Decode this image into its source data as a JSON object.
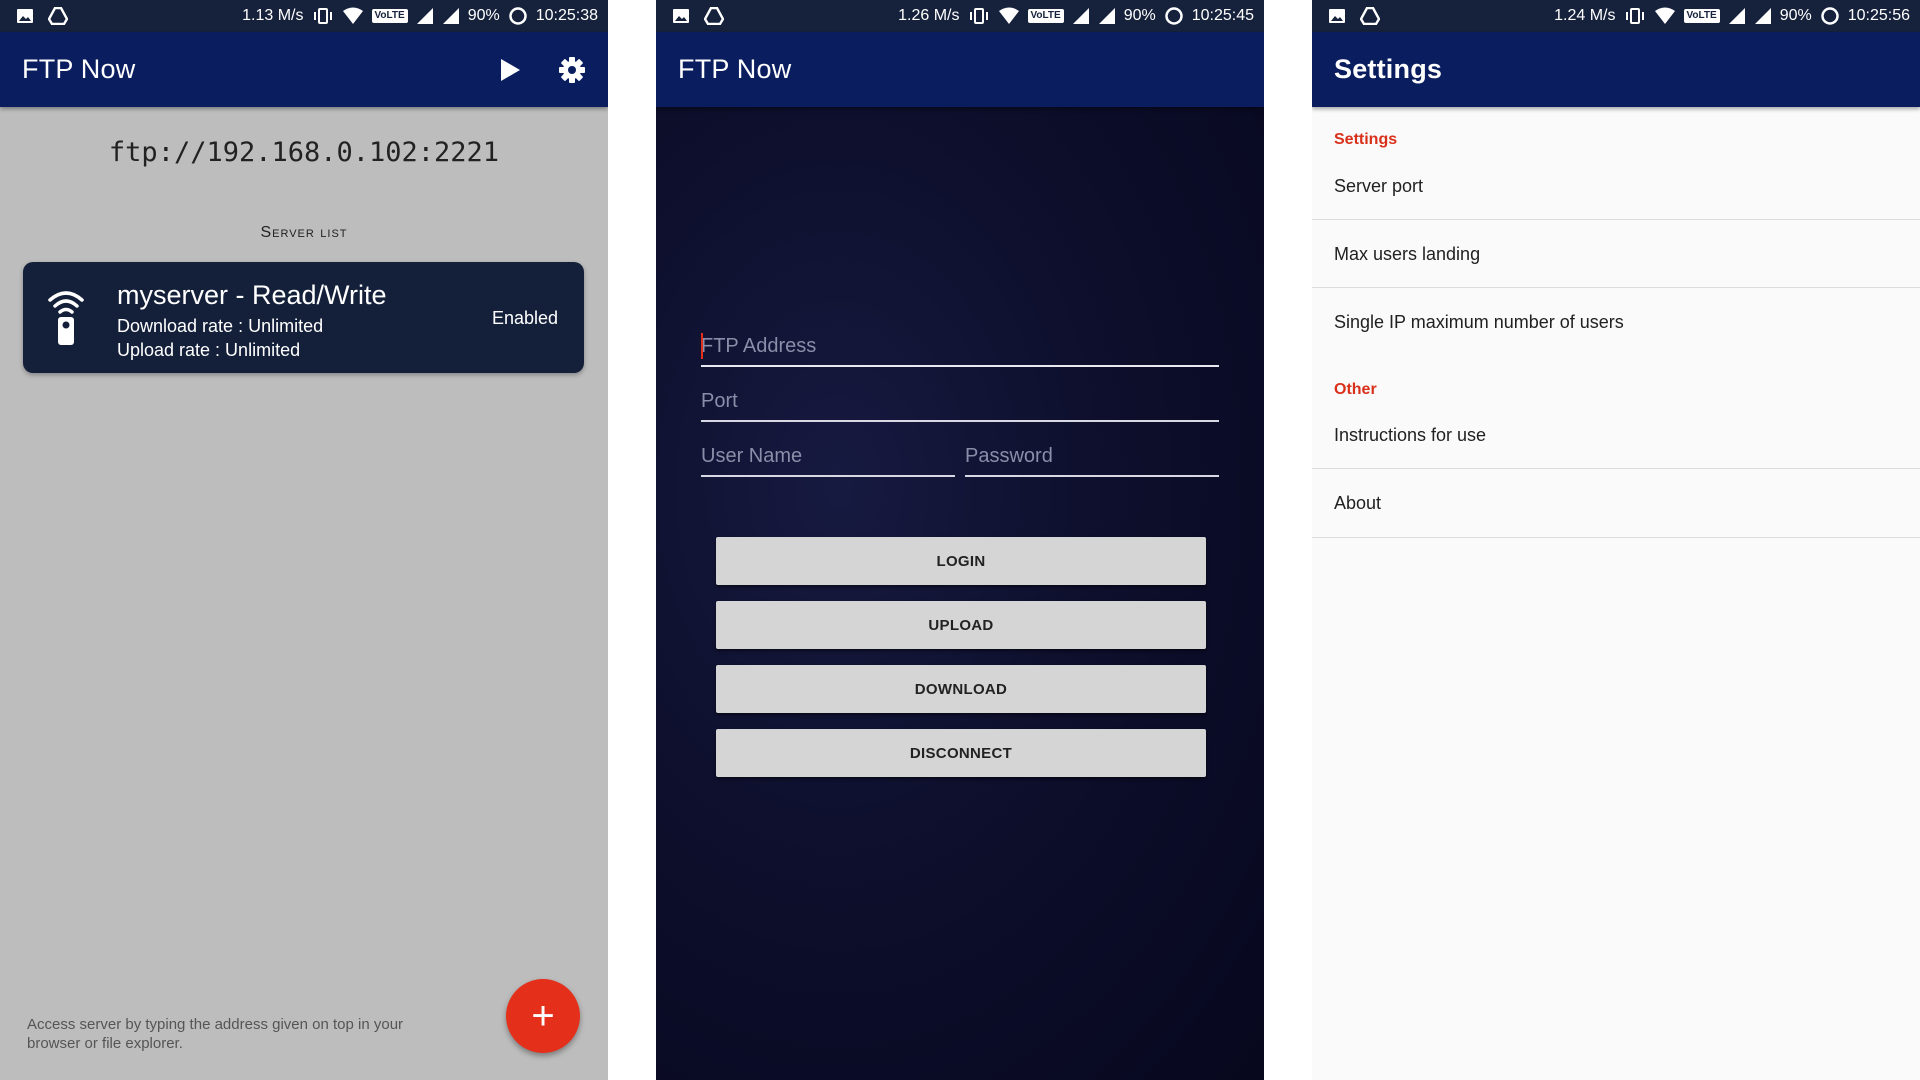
{
  "screens": [
    {
      "status": {
        "speed": "1.13 M/s",
        "lte": "VoLTE",
        "battery": "90%",
        "time": "10:25:38"
      },
      "title": "FTP Now",
      "ftp_url": "ftp://192.168.0.102:2221",
      "server_list_label": "Server list",
      "server": {
        "name": "myserver - Read/Write",
        "download": "Download rate : Unlimited",
        "upload": "Upload rate : Unlimited",
        "status": "Enabled"
      },
      "footer_hint": "Access server by typing the address given on top in your browser or file explorer.",
      "fab_label": "+"
    },
    {
      "status": {
        "speed": "1.26 M/s",
        "lte": "VoLTE",
        "battery": "90%",
        "time": "10:25:45"
      },
      "title": "FTP Now",
      "fields": {
        "ftp_address": "FTP Address",
        "port": "Port",
        "user_name": "User Name",
        "password": "Password"
      },
      "buttons": {
        "login": "LOGIN",
        "upload": "UPLOAD",
        "download": "DOWNLOAD",
        "disconnect": "DISCONNECT"
      }
    },
    {
      "status": {
        "speed": "1.24 M/s",
        "lte": "VoLTE",
        "battery": "90%",
        "time": "10:25:56"
      },
      "title": "Settings",
      "categories": {
        "settings": "Settings",
        "other": "Other"
      },
      "items": {
        "server_port": "Server port",
        "max_users": "Max users landing",
        "single_ip": "Single IP maximum number of users",
        "instructions": "Instructions for use",
        "about": "About"
      }
    }
  ],
  "colors": {
    "appbar": "#0a1d5e",
    "statusbar": "#16213b",
    "accent": "#e4301a",
    "card": "#14203a"
  }
}
